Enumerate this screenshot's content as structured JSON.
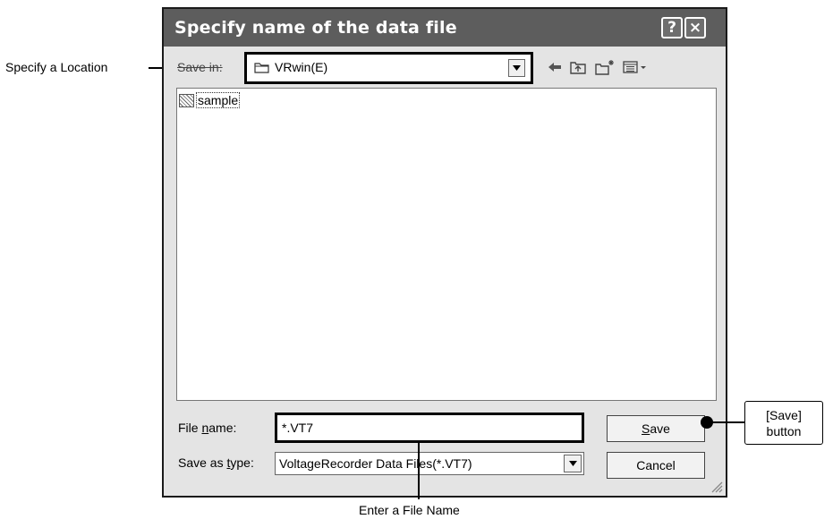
{
  "dialog": {
    "title": "Specify name of the data file",
    "help_button": "?",
    "close_button": "×",
    "save_in_label": "Save in:",
    "location_value": "VRwin(E)",
    "files": [
      {
        "name": "sample",
        "icon": "data-file-icon"
      }
    ],
    "file_name_label_pre": "File ",
    "file_name_label_key": "n",
    "file_name_label_post": "ame:",
    "file_name_value": "*.VT7",
    "save_as_type_label_pre": "Save as ",
    "save_as_type_label_key": "t",
    "save_as_type_label_post": "ype:",
    "save_as_type_value": "VoltageRecorder Data Files(*.VT7)",
    "save_button_key": "S",
    "save_button_rest": "ave",
    "cancel_button": "Cancel"
  },
  "callouts": {
    "location": "Specify a Location",
    "file_name": "Enter a File Name",
    "save_line1": "[Save]",
    "save_line2": "button"
  },
  "icons": [
    "help-icon",
    "close-icon",
    "folder-icon",
    "dropdown-arrow-icon",
    "back-arrow-icon",
    "up-folder-icon",
    "new-folder-icon",
    "view-menu-icon",
    "data-file-icon",
    "resize-grip-icon"
  ],
  "colors": {
    "titlebar": "#5d5d5d",
    "dialog_bg": "#e4e4e4",
    "highlight_border": "#000000"
  }
}
